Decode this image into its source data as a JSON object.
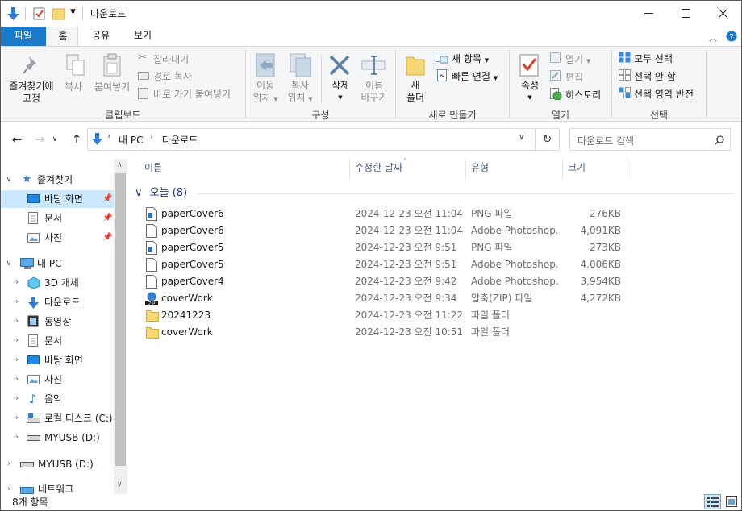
{
  "window": {
    "title": "다운로드",
    "quick_access_toolbar": [
      "properties-icon",
      "new-folder-icon",
      "customize-dropdown-icon"
    ]
  },
  "ribbon_tabs": [
    "파일",
    "홈",
    "공유",
    "보기"
  ],
  "ribbon": {
    "clipboard": {
      "pin": "즐겨찾기에\n고정",
      "pin_l1": "즐겨찾기에",
      "pin_l2": "고정",
      "copy": "복사",
      "paste": "붙여넣기",
      "cut": "잘라내기",
      "copy_path": "경로 복사",
      "paste_shortcut": "바로 가기 붙여넣기",
      "label": "클립보드"
    },
    "organize": {
      "move_l1": "이동",
      "move_l2": "위치",
      "copy_l1": "복사",
      "copy_l2": "위치",
      "delete": "삭제",
      "rename_l1": "이름",
      "rename_l2": "바꾸기",
      "label": "구성"
    },
    "new": {
      "folder_l1": "새",
      "folder_l2": "폴더",
      "new_item": "새 항목",
      "easy_access": "빠른 연결",
      "label": "새로 만들기"
    },
    "open": {
      "properties": "속성",
      "open": "열기",
      "edit": "편집",
      "history": "히스토리",
      "label": "열기"
    },
    "select": {
      "select_all": "모두 선택",
      "select_none": "선택 안 함",
      "invert": "선택 영역 반전",
      "label": "선택"
    }
  },
  "address": {
    "crumb1": "내 PC",
    "crumb2": "다운로드",
    "search_placeholder": "다운로드 검색"
  },
  "nav_pane": {
    "quick_access": "즐겨찾기",
    "qa_items": [
      "바탕 화면",
      "문서",
      "사진"
    ],
    "this_pc": "내 PC",
    "pc_items": [
      "3D 개체",
      "다운로드",
      "동영상",
      "문서",
      "바탕 화면",
      "사진",
      "음악",
      "로컬 디스크 (C:)",
      "MYUSB (D:)"
    ],
    "usb": "MYUSB (D:)",
    "network": "네트워크"
  },
  "columns": [
    "이름",
    "수정한 날짜",
    "유형",
    "크기"
  ],
  "group": {
    "label": "오늘",
    "count": "(8)"
  },
  "files": [
    {
      "name": "paperCover6",
      "date": "2024-12-23 오전 11:04",
      "type": "PNG 파일",
      "size": "276KB",
      "icon": "png-file-icon"
    },
    {
      "name": "paperCover6",
      "date": "2024-12-23 오전 11:04",
      "type": "Adobe Photoshop...",
      "size": "4,091KB",
      "icon": "psd-file-icon"
    },
    {
      "name": "paperCover5",
      "date": "2024-12-23 오전 9:51",
      "type": "PNG 파일",
      "size": "273KB",
      "icon": "png-file-icon"
    },
    {
      "name": "paperCover5",
      "date": "2024-12-23 오전 9:51",
      "type": "Adobe Photoshop...",
      "size": "4,006KB",
      "icon": "psd-file-icon"
    },
    {
      "name": "paperCover4",
      "date": "2024-12-23 오전 9:42",
      "type": "Adobe Photoshop...",
      "size": "3,954KB",
      "icon": "psd-file-icon"
    },
    {
      "name": "coverWork",
      "date": "2024-12-23 오전 9:34",
      "type": "압축(ZIP) 파일",
      "size": "4,272KB",
      "icon": "zip-file-icon"
    },
    {
      "name": "20241223",
      "date": "2024-12-23 오전 11:22",
      "type": "파일 폴더",
      "size": "",
      "icon": "folder-icon"
    },
    {
      "name": "coverWork",
      "date": "2024-12-23 오전 10:51",
      "type": "파일 폴더",
      "size": "",
      "icon": "folder-icon"
    }
  ],
  "status": {
    "count": "8개 항목"
  },
  "colors": {
    "accent": "#1979ca",
    "selection": "#cce8ff",
    "folder": "#f8d775"
  }
}
